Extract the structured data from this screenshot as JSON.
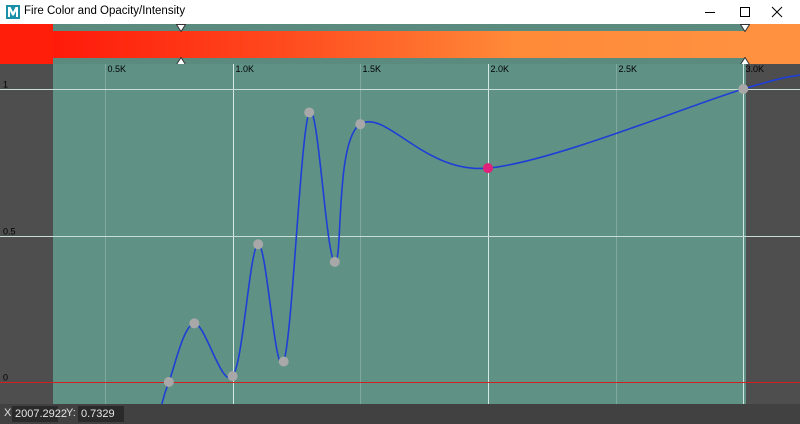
{
  "window": {
    "title": "Fire Color and Opacity/Intensity",
    "icon": "maya-logo-icon",
    "controls": [
      "minimize-icon",
      "maximize-icon",
      "close-icon"
    ]
  },
  "gradient": {
    "left_color": "#ff1e0a",
    "right_color": "#ff9140",
    "stops": [
      "#ff1a0a",
      "#ff4a1e",
      "#ff8a38",
      "#ff9140"
    ]
  },
  "axes": {
    "x_ticks": [
      "0.5K",
      "1.0K",
      "1.5K",
      "2.0K",
      "2.5K",
      "3.0K"
    ],
    "y_ticks": [
      "1",
      "0.5",
      "0"
    ]
  },
  "chart_data": {
    "type": "line",
    "x": [
      750,
      850,
      1000,
      1100,
      1200,
      1300,
      1400,
      1500,
      2000,
      3000
    ],
    "y": [
      0.0,
      0.2,
      0.02,
      0.47,
      0.07,
      0.92,
      0.41,
      0.88,
      0.73,
      1.0
    ],
    "selected_x": 2000,
    "xlim": [
      300,
      3200
    ],
    "ylim": [
      0,
      1
    ],
    "x_tick_values": [
      500,
      1000,
      1500,
      2000,
      2500,
      3000
    ],
    "y_tick_values": [
      1,
      0.5,
      0
    ],
    "title": "",
    "xlabel": "",
    "ylabel": "",
    "colors": {
      "curve": "#1e3fd6",
      "key": "#a8a8a8",
      "selected": "#e0207a",
      "baseline": "#d02020",
      "grid": "#c8ddd6"
    }
  },
  "status": {
    "x_label": "X",
    "x_value": "2007.2922",
    "y_label": "Y:",
    "y_value": "0.7329"
  }
}
